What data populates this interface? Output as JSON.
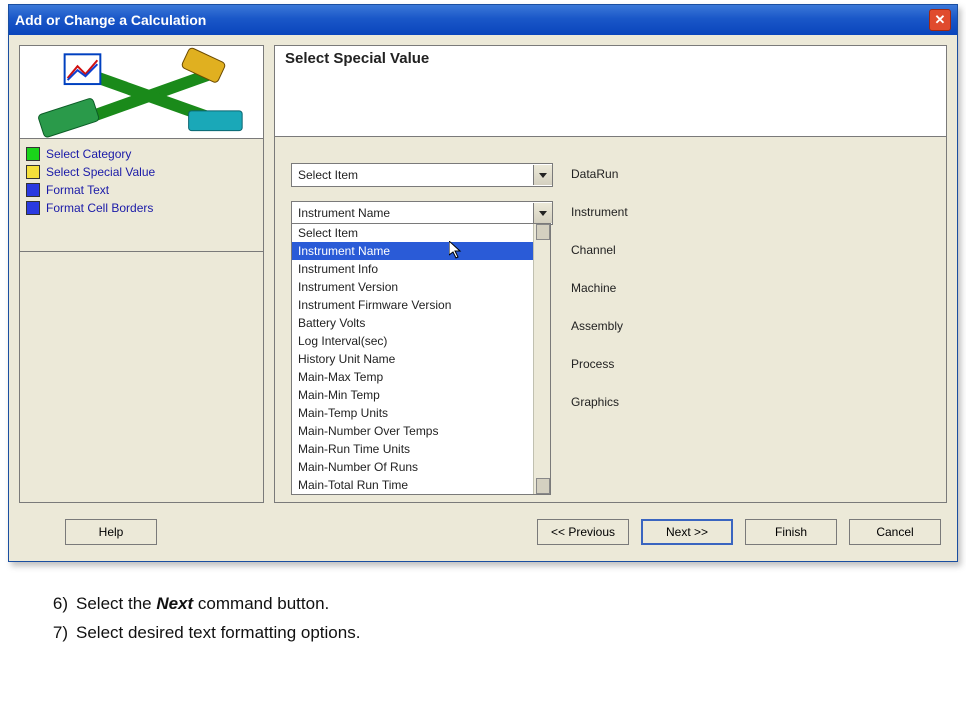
{
  "window": {
    "title": "Add or Change a Calculation"
  },
  "heading": "Select Special Value",
  "steps": [
    {
      "color": "g",
      "label": "Select Category"
    },
    {
      "color": "y",
      "label": "Select Special Value"
    },
    {
      "color": "b",
      "label": "Format Text"
    },
    {
      "color": "b",
      "label": "Format Cell Borders"
    }
  ],
  "combo1": {
    "text": "Select Item"
  },
  "combo2": {
    "text": "Instrument Name"
  },
  "dropdown_options": [
    "Select Item",
    "Instrument Name",
    "Instrument Info",
    "Instrument Version",
    "Instrument Firmware Version",
    "Battery Volts",
    "Log Interval(sec)",
    "History Unit Name",
    "Main-Max Temp",
    "Main-Min Temp",
    "Main-Temp Units",
    "Main-Number Over Temps",
    "Main-Run Time Units",
    "Main-Number Of Runs",
    "Main-Total Run Time"
  ],
  "dropdown_selected_index": 1,
  "categories": [
    "DataRun",
    "Instrument",
    "Channel",
    "Machine",
    "Assembly",
    "Process",
    "Graphics"
  ],
  "buttons": {
    "help": "Help",
    "prev": "<< Previous",
    "next": "Next >>",
    "finish": "Finish",
    "cancel": "Cancel"
  },
  "instructions": [
    {
      "num": "6)",
      "prefix": "Select the ",
      "bold": "Next",
      "suffix": " command button."
    },
    {
      "num": "7)",
      "prefix": "Select desired text formatting options.",
      "bold": "",
      "suffix": ""
    }
  ]
}
